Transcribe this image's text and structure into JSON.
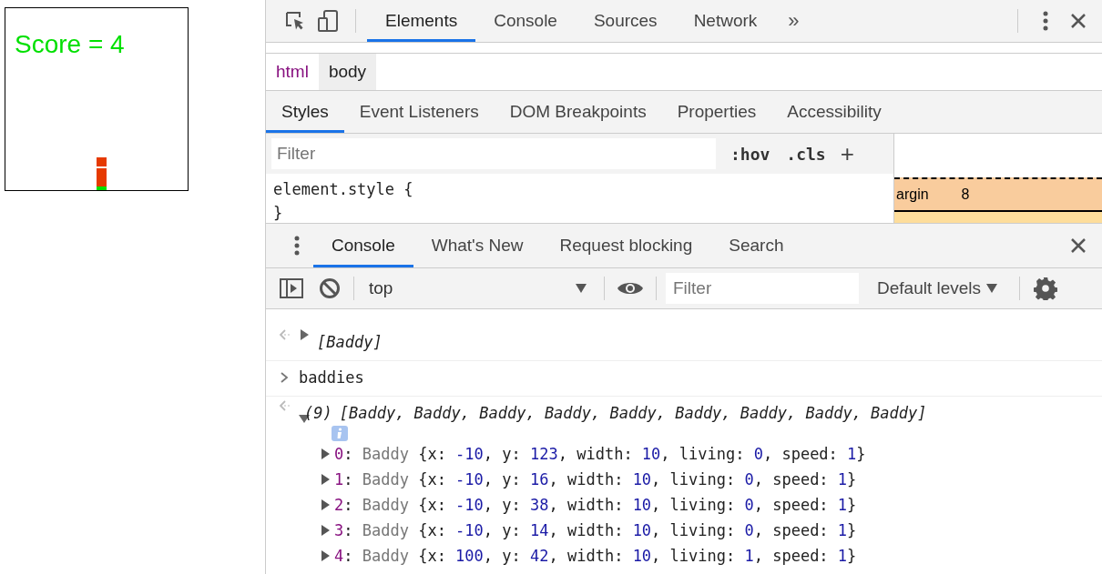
{
  "page": {
    "score": "Score = 4"
  },
  "devtools": {
    "tabs": [
      {
        "label": "Elements",
        "selected": true
      },
      {
        "label": "Console",
        "selected": false
      },
      {
        "label": "Sources",
        "selected": false
      },
      {
        "label": "Network",
        "selected": false
      }
    ],
    "more": "»",
    "breadcrumbs": [
      {
        "label": "html",
        "kind": "tag",
        "selected": false
      },
      {
        "label": "body",
        "kind": "tag",
        "selected": true
      }
    ],
    "sidebar_tabs": [
      {
        "label": "Styles",
        "selected": true
      },
      {
        "label": "Event Listeners",
        "selected": false
      },
      {
        "label": "DOM Breakpoints",
        "selected": false
      },
      {
        "label": "Properties",
        "selected": false
      },
      {
        "label": "Accessibility",
        "selected": false
      }
    ],
    "styles": {
      "filter_placeholder": "Filter",
      "hov": ":hov",
      "cls": ".cls",
      "add": "+",
      "rule_open": "element.style {",
      "rule_close": "}"
    },
    "box_model": {
      "label": "argin",
      "value": "8"
    },
    "drawer_tabs": [
      {
        "label": "Console",
        "selected": true
      },
      {
        "label": "What's New",
        "selected": false
      },
      {
        "label": "Request blocking",
        "selected": false
      },
      {
        "label": "Search",
        "selected": false
      }
    ],
    "console_toolbar": {
      "context": "top",
      "filter_placeholder": "Filter",
      "levels": "Default levels"
    },
    "console": [
      {
        "kind": "output",
        "expanded": false,
        "summary": "[Baddy]"
      },
      {
        "kind": "input",
        "text": "baddies"
      },
      {
        "kind": "output",
        "expanded": true,
        "count": "(9)",
        "summary": "[Baddy, Baddy, Baddy, Baddy, Baddy, Baddy, Baddy, Baddy, Baddy]",
        "rows": [
          {
            "parts": [
              {
                "text": "0",
                "kind": "idx"
              },
              {
                "text": ": ",
                "kind": "p"
              },
              {
                "text": "Baddy ",
                "kind": "cls"
              },
              {
                "text": "{x: ",
                "kind": "p"
              },
              {
                "text": "-10",
                "kind": "num"
              },
              {
                "text": ", y: ",
                "kind": "p"
              },
              {
                "text": "123",
                "kind": "num"
              },
              {
                "text": ", width: ",
                "kind": "p"
              },
              {
                "text": "10",
                "kind": "num"
              },
              {
                "text": ", living: ",
                "kind": "p"
              },
              {
                "text": "0",
                "kind": "num"
              },
              {
                "text": ", speed: ",
                "kind": "p"
              },
              {
                "text": "1",
                "kind": "num"
              },
              {
                "text": "}",
                "kind": "p"
              }
            ]
          },
          {
            "parts": [
              {
                "text": "1",
                "kind": "idx"
              },
              {
                "text": ": ",
                "kind": "p"
              },
              {
                "text": "Baddy ",
                "kind": "cls"
              },
              {
                "text": "{x: ",
                "kind": "p"
              },
              {
                "text": "-10",
                "kind": "num"
              },
              {
                "text": ", y: ",
                "kind": "p"
              },
              {
                "text": "16",
                "kind": "num"
              },
              {
                "text": ", width: ",
                "kind": "p"
              },
              {
                "text": "10",
                "kind": "num"
              },
              {
                "text": ", living: ",
                "kind": "p"
              },
              {
                "text": "0",
                "kind": "num"
              },
              {
                "text": ", speed: ",
                "kind": "p"
              },
              {
                "text": "1",
                "kind": "num"
              },
              {
                "text": "}",
                "kind": "p"
              }
            ]
          },
          {
            "parts": [
              {
                "text": "2",
                "kind": "idx"
              },
              {
                "text": ": ",
                "kind": "p"
              },
              {
                "text": "Baddy ",
                "kind": "cls"
              },
              {
                "text": "{x: ",
                "kind": "p"
              },
              {
                "text": "-10",
                "kind": "num"
              },
              {
                "text": ", y: ",
                "kind": "p"
              },
              {
                "text": "38",
                "kind": "num"
              },
              {
                "text": ", width: ",
                "kind": "p"
              },
              {
                "text": "10",
                "kind": "num"
              },
              {
                "text": ", living: ",
                "kind": "p"
              },
              {
                "text": "0",
                "kind": "num"
              },
              {
                "text": ", speed: ",
                "kind": "p"
              },
              {
                "text": "1",
                "kind": "num"
              },
              {
                "text": "}",
                "kind": "p"
              }
            ]
          },
          {
            "parts": [
              {
                "text": "3",
                "kind": "idx"
              },
              {
                "text": ": ",
                "kind": "p"
              },
              {
                "text": "Baddy ",
                "kind": "cls"
              },
              {
                "text": "{x: ",
                "kind": "p"
              },
              {
                "text": "-10",
                "kind": "num"
              },
              {
                "text": ", y: ",
                "kind": "p"
              },
              {
                "text": "14",
                "kind": "num"
              },
              {
                "text": ", width: ",
                "kind": "p"
              },
              {
                "text": "10",
                "kind": "num"
              },
              {
                "text": ", living: ",
                "kind": "p"
              },
              {
                "text": "0",
                "kind": "num"
              },
              {
                "text": ", speed: ",
                "kind": "p"
              },
              {
                "text": "1",
                "kind": "num"
              },
              {
                "text": "}",
                "kind": "p"
              }
            ]
          },
          {
            "parts": [
              {
                "text": "4",
                "kind": "idx"
              },
              {
                "text": ": ",
                "kind": "p"
              },
              {
                "text": "Baddy ",
                "kind": "cls"
              },
              {
                "text": "{x: ",
                "kind": "p"
              },
              {
                "text": "100",
                "kind": "num"
              },
              {
                "text": ", y: ",
                "kind": "p"
              },
              {
                "text": "42",
                "kind": "num"
              },
              {
                "text": ", width: ",
                "kind": "p"
              },
              {
                "text": "10",
                "kind": "num"
              },
              {
                "text": ", living: ",
                "kind": "p"
              },
              {
                "text": "1",
                "kind": "num"
              },
              {
                "text": ", speed: ",
                "kind": "p"
              },
              {
                "text": "1",
                "kind": "num"
              },
              {
                "text": "}",
                "kind": "p"
              }
            ]
          }
        ]
      }
    ]
  }
}
